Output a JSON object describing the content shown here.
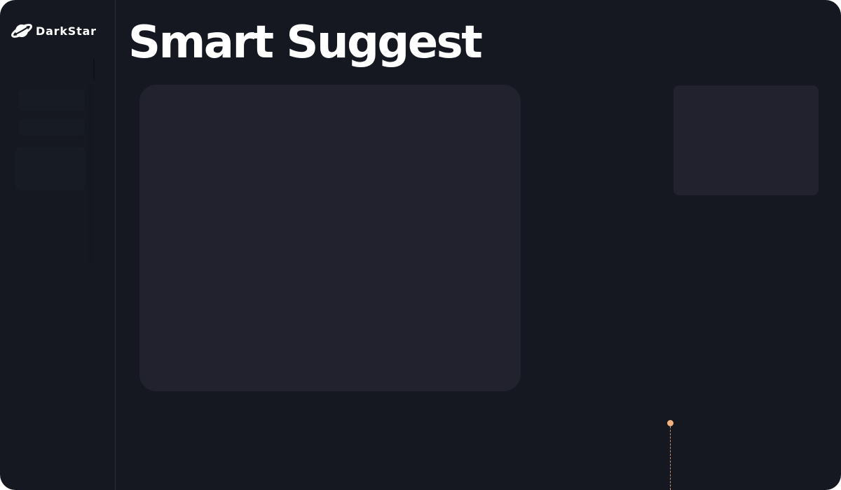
{
  "brand": {
    "name": "DarkStar",
    "logo_icon": "planet-icon"
  },
  "header": {
    "title": "Smart Suggest"
  },
  "colors": {
    "background": "#151820",
    "card": "#21222d",
    "text": "#ffffff",
    "accent": "#f2b27a"
  }
}
